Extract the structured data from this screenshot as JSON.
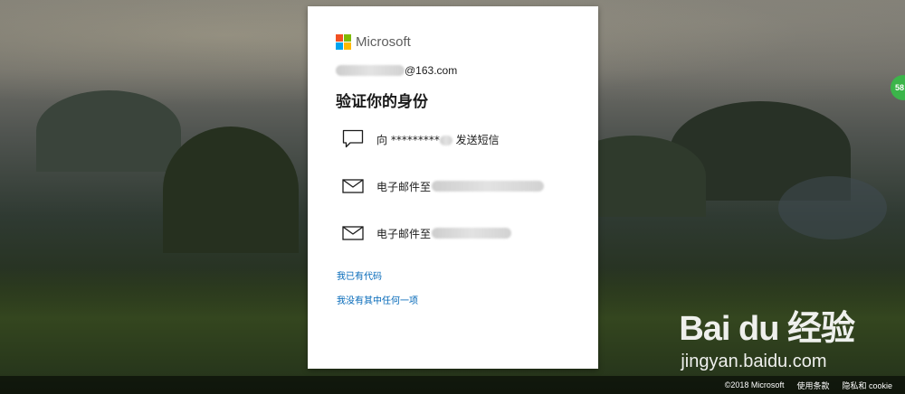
{
  "brand": {
    "name": "Microsoft",
    "colors": [
      "#f25022",
      "#7fba00",
      "#00a4ef",
      "#ffb900"
    ]
  },
  "account": {
    "visible_suffix": "@163.com"
  },
  "page_title": "验证你的身份",
  "options": [
    {
      "icon": "chat-bubble-icon",
      "prefix": "向 ",
      "masked": "*********",
      "suffix": " 发送短信"
    },
    {
      "icon": "mail-icon",
      "label": "电子邮件至"
    },
    {
      "icon": "mail-icon",
      "label": "电子邮件至"
    }
  ],
  "links": {
    "have_code": "我已有代码",
    "none_of_these": "我没有其中任何一项"
  },
  "footer": {
    "copyright": "©2018 Microsoft",
    "terms": "使用条款",
    "privacy": "隐私和 cookie"
  },
  "side_badge": "58",
  "watermark": {
    "brand": "Bai du 经验",
    "site": "jingyan.baidu.com"
  },
  "colors": {
    "link": "#0067b8",
    "text": "#1b1b1b",
    "card": "#ffffff",
    "badge": "#3bb54a"
  }
}
